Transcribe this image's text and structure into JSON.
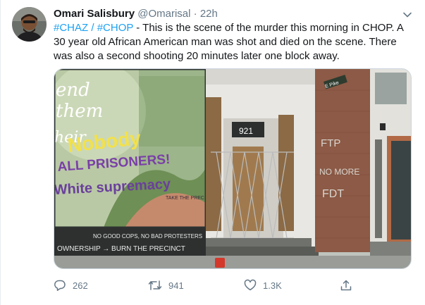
{
  "author": {
    "name": "Omari Salisbury",
    "handle": "@Omarisal",
    "separator": "·",
    "time": "22h"
  },
  "tweet": {
    "hashtag1": "#CHAZ",
    "slash": " / ",
    "hashtag2": "#CHOP",
    "body": " - This is the scene of the murder this morning in CHOP. A 30 year old African American man was shot and died on the scene. There was also a second shooting 20 minutes later one block away."
  },
  "media": {
    "address_number": "921",
    "street_sign": "E Pike",
    "graffiti_1": "Nobody",
    "graffiti_2": "ALL PRISONERS!",
    "graffiti_3": "White supremacy",
    "graffiti_4": "TAKE THE PRECINCT",
    "graffiti_5": "NO GOOD COPS, NO BAD PROTESTERS",
    "graffiti_6": "OWNERSHIP → BURN THE PRECINCT",
    "graffiti_7": "FTP",
    "graffiti_8": "NO MORE",
    "graffiti_9": "FDT",
    "mural_text_1": "end",
    "mural_text_2": "them",
    "mural_text_3": "heir"
  },
  "actions": {
    "replies": "262",
    "retweets": "941",
    "likes": "1.3K"
  },
  "colors": {
    "accent": "#1da1f2",
    "secondary_text": "#657786"
  }
}
